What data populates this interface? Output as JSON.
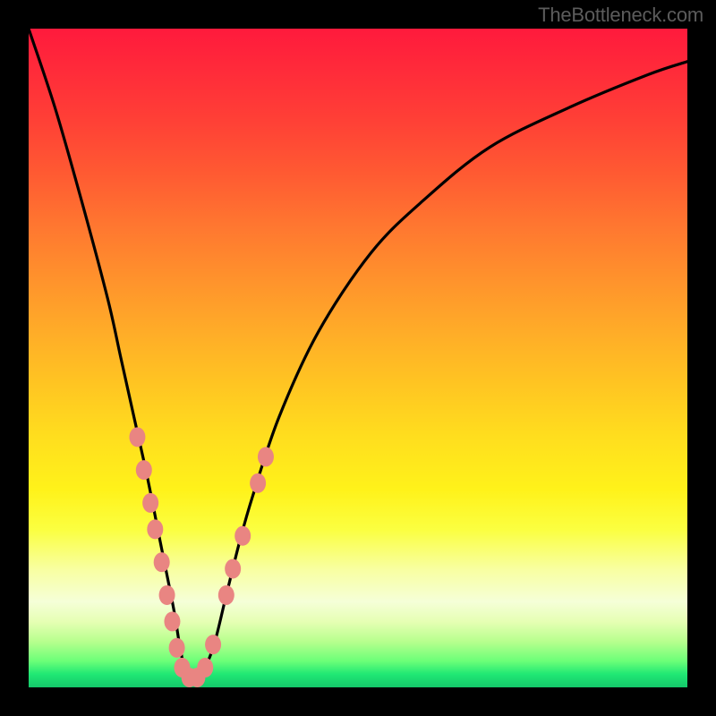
{
  "attribution": "TheBottleneck.com",
  "chart_data": {
    "type": "line",
    "title": "",
    "xlabel": "",
    "ylabel": "",
    "xlim": [
      0,
      100
    ],
    "ylim": [
      0,
      100
    ],
    "series": [
      {
        "name": "bottleneck-curve",
        "x": [
          0,
          4,
          8,
          12,
          14,
          16,
          18,
          20,
          22,
          23,
          24,
          26,
          28,
          30,
          32,
          34,
          38,
          44,
          52,
          60,
          70,
          82,
          94,
          100
        ],
        "values": [
          100,
          88,
          74,
          59,
          50,
          41,
          32,
          22,
          12,
          6,
          2,
          2,
          6,
          14,
          22,
          29,
          41,
          54,
          66,
          74,
          82,
          88,
          93,
          95
        ]
      }
    ],
    "markers": {
      "name": "highlight-dots",
      "color": "#e98582",
      "points": [
        {
          "x": 16.5,
          "y": 38
        },
        {
          "x": 17.5,
          "y": 33
        },
        {
          "x": 18.5,
          "y": 28
        },
        {
          "x": 19.2,
          "y": 24
        },
        {
          "x": 20.2,
          "y": 19
        },
        {
          "x": 21.0,
          "y": 14
        },
        {
          "x": 21.8,
          "y": 10
        },
        {
          "x": 22.5,
          "y": 6
        },
        {
          "x": 23.3,
          "y": 3
        },
        {
          "x": 24.4,
          "y": 1.5
        },
        {
          "x": 25.6,
          "y": 1.5
        },
        {
          "x": 26.8,
          "y": 3
        },
        {
          "x": 28.0,
          "y": 6.5
        },
        {
          "x": 30.0,
          "y": 14
        },
        {
          "x": 31.0,
          "y": 18
        },
        {
          "x": 32.5,
          "y": 23
        },
        {
          "x": 34.8,
          "y": 31
        },
        {
          "x": 36.0,
          "y": 35
        }
      ]
    }
  }
}
